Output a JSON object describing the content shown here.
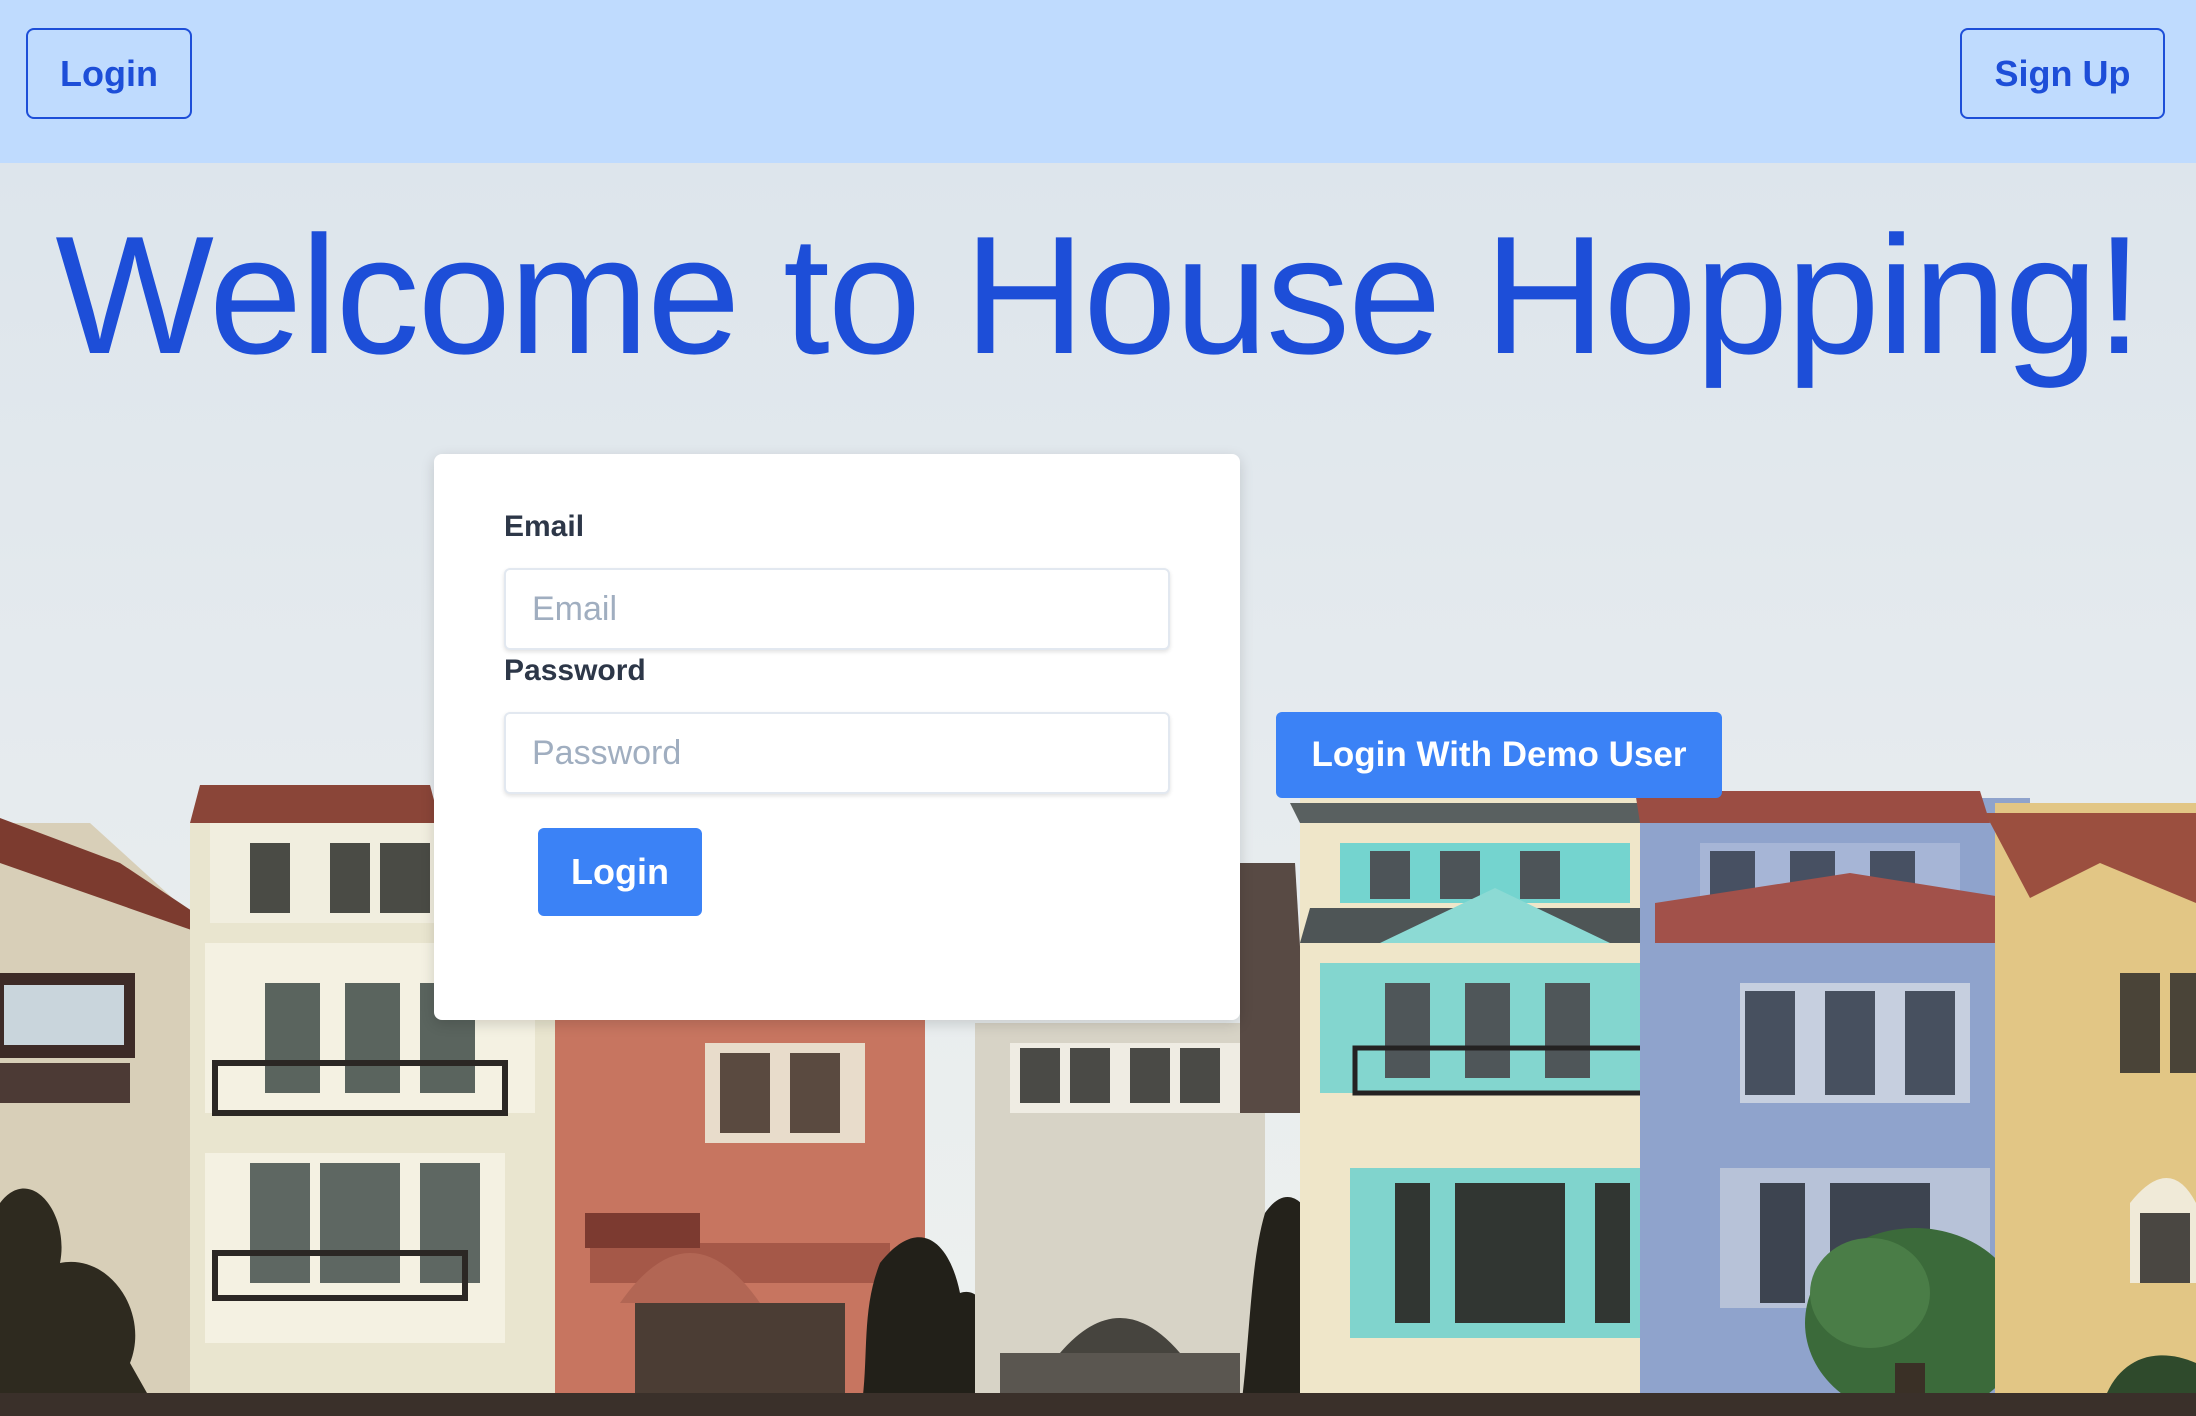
{
  "header": {
    "login_label": "Login",
    "signup_label": "Sign Up"
  },
  "hero": {
    "title": "Welcome to House Hopping!"
  },
  "login_form": {
    "email_label": "Email",
    "email_placeholder": "Email",
    "password_label": "Password",
    "password_placeholder": "Password",
    "submit_label": "Login"
  },
  "demo": {
    "label": "Login With Demo User"
  },
  "colors": {
    "topbar": "#bfdbfe",
    "accent": "#1d4ed8",
    "button": "#3b82f6"
  },
  "background": {
    "image": "row-of-colorful-houses-photo"
  }
}
